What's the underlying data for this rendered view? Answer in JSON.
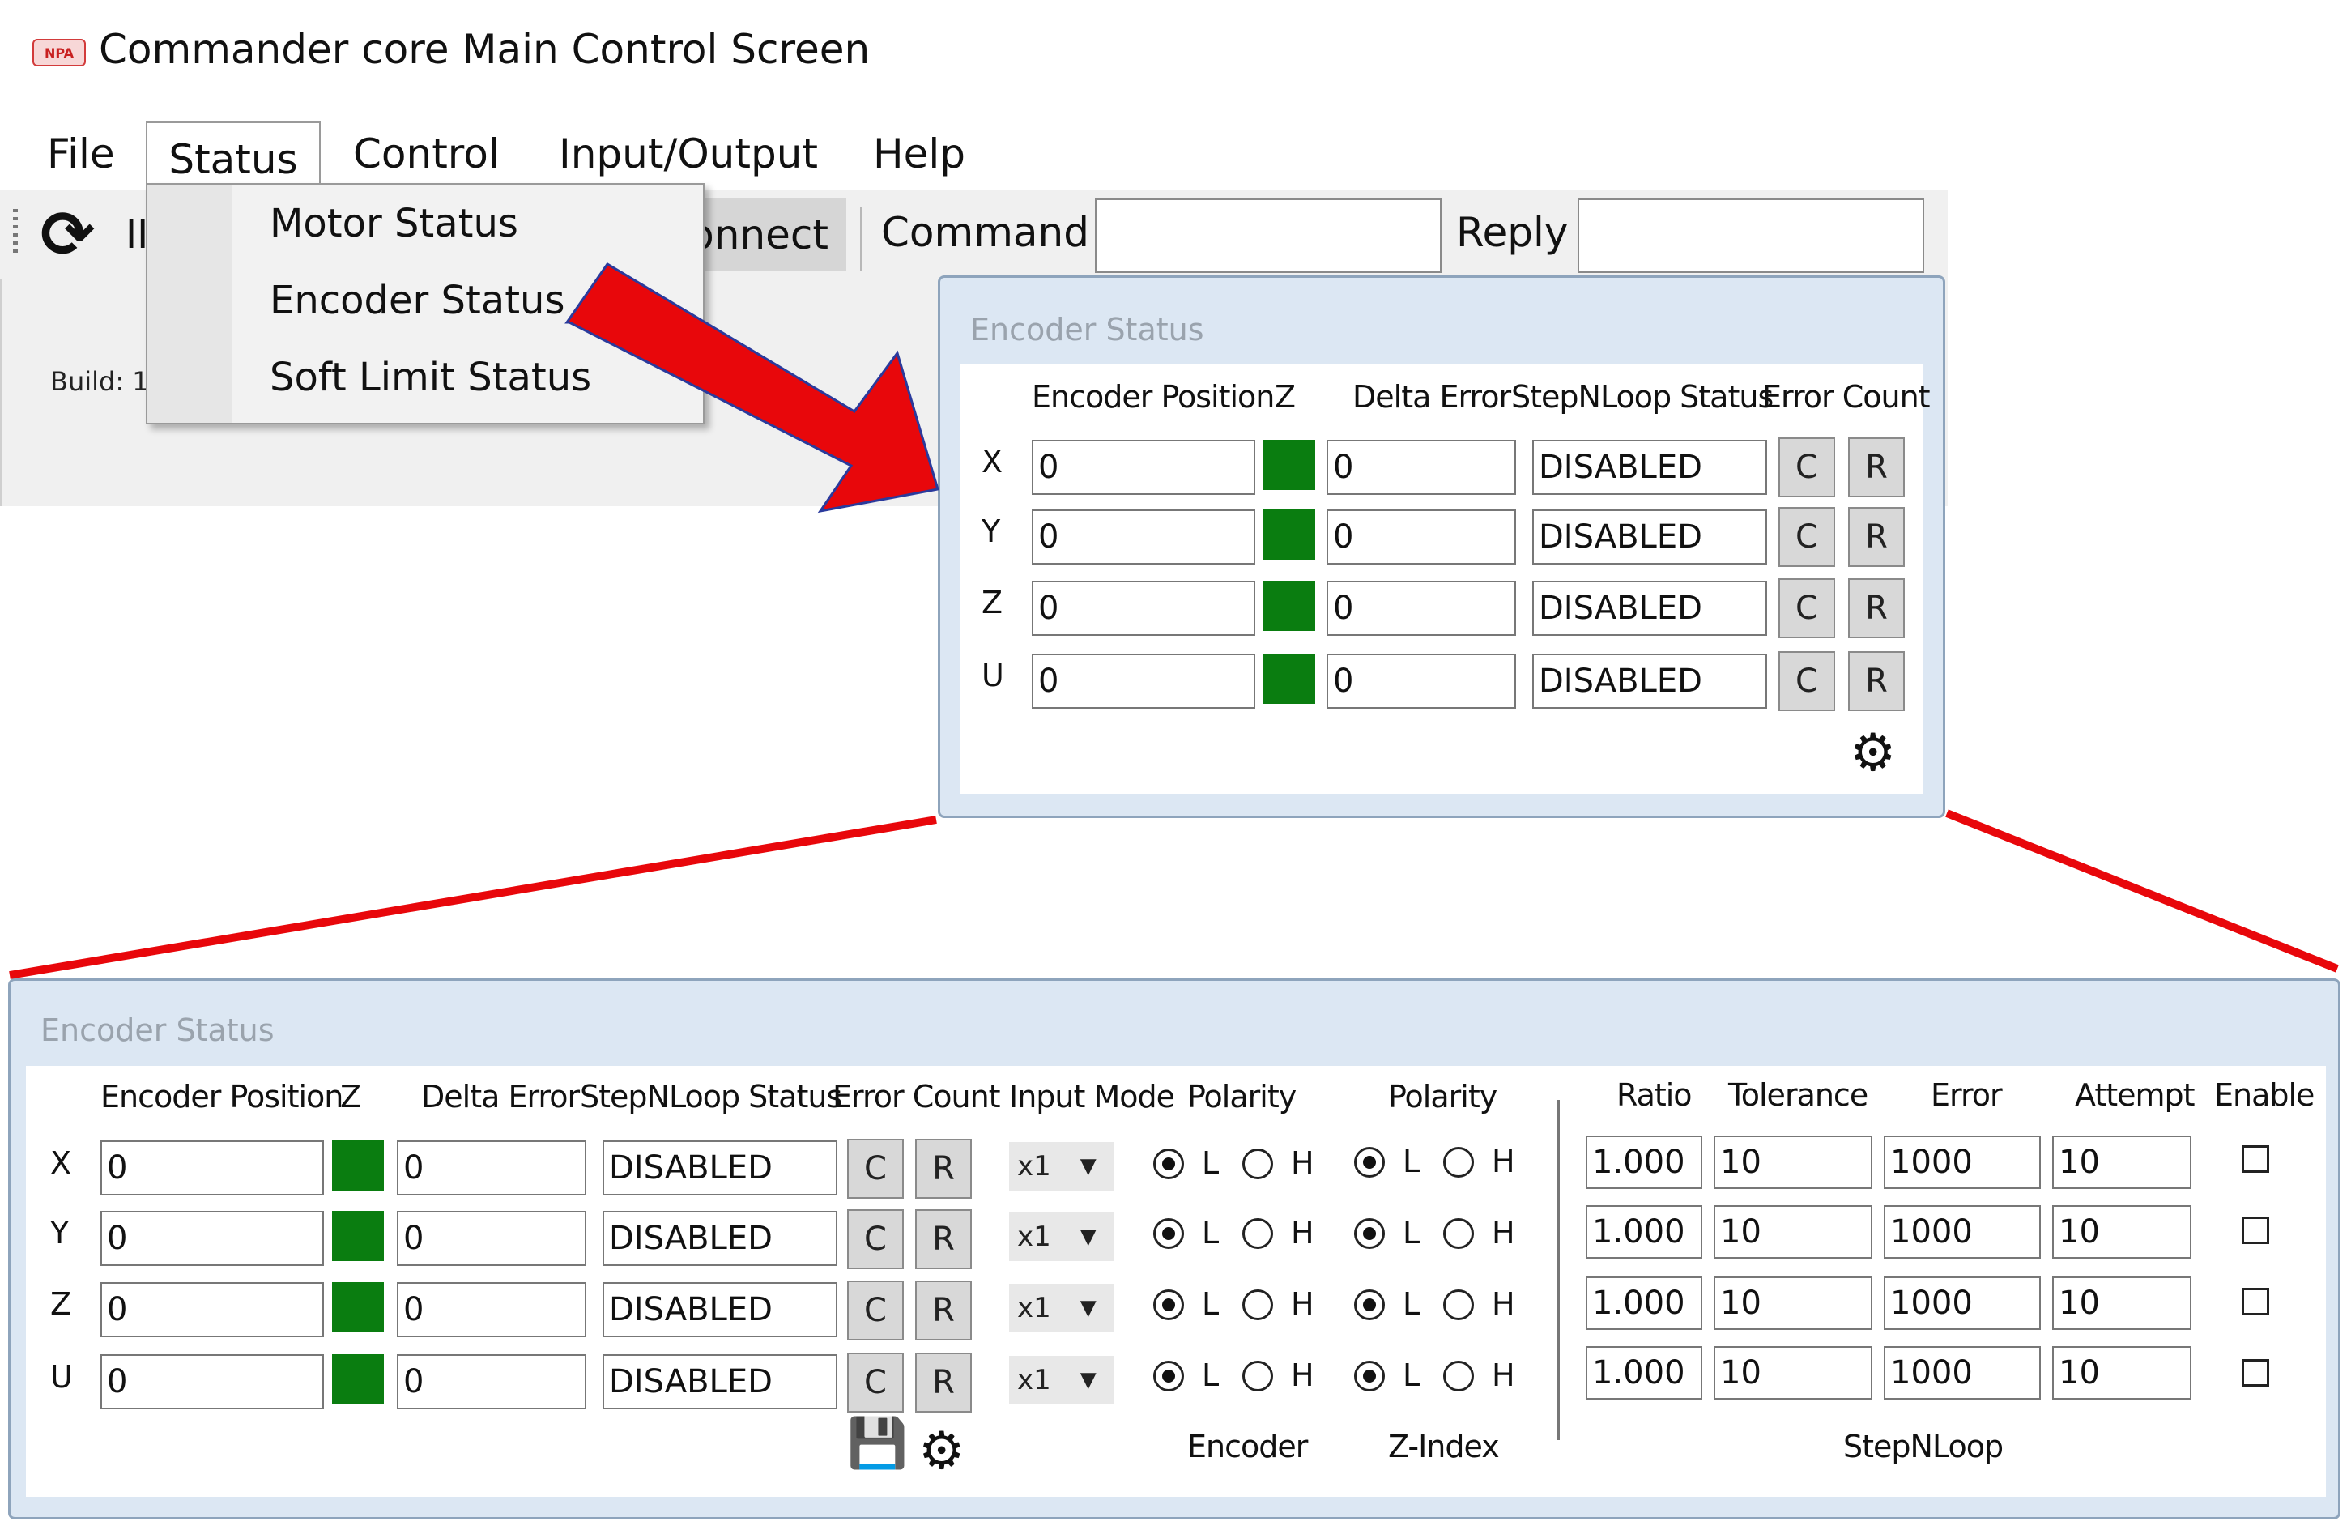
{
  "window": {
    "title": "Commander core Main Control Screen",
    "logo_text": "NPA"
  },
  "menu": {
    "file": "File",
    "status": "Status",
    "control": "Control",
    "io": "Input/Output",
    "help": "Help"
  },
  "dropdown": {
    "items": [
      "Motor Status",
      "Encoder Status",
      "Soft Limit Status"
    ]
  },
  "toolbar": {
    "clipped_label": "II",
    "connect_label": "onnect",
    "command_label": "Command",
    "command_value": "",
    "reply_label": "Reply",
    "reply_value": ""
  },
  "build_label": "Build: 1",
  "small_dialog": {
    "title": "Encoder Status",
    "headers": {
      "encoder_position": "Encoder Position",
      "z": "Z",
      "delta_error": "Delta Error",
      "stepnloop_status": "StepNLoop Status",
      "error_count": "Error Count"
    },
    "rows": [
      {
        "axis": "X",
        "position": "0",
        "delta": "0",
        "status": "DISABLED",
        "c": "C",
        "r": "R"
      },
      {
        "axis": "Y",
        "position": "0",
        "delta": "0",
        "status": "DISABLED",
        "c": "C",
        "r": "R"
      },
      {
        "axis": "Z",
        "position": "0",
        "delta": "0",
        "status": "DISABLED",
        "c": "C",
        "r": "R"
      },
      {
        "axis": "U",
        "position": "0",
        "delta": "0",
        "status": "DISABLED",
        "c": "C",
        "r": "R"
      }
    ]
  },
  "large_dialog": {
    "title": "Encoder Status",
    "headers": {
      "encoder_position": "Encoder Position",
      "z": "Z",
      "delta_error": "Delta Error",
      "stepnloop_status": "StepNLoop Status",
      "error_count": "Error Count",
      "input_mode": "Input Mode",
      "polarity_encoder": "Polarity",
      "polarity_zindex": "Polarity",
      "ratio": "Ratio",
      "tolerance": "Tolerance",
      "error": "Error",
      "attempt": "Attempt",
      "enable": "Enable"
    },
    "group_labels": {
      "encoder": "Encoder",
      "zindex": "Z-Index",
      "stepnloop": "StepNLoop"
    },
    "radio_labels": {
      "low": "L",
      "high": "H"
    },
    "rows": [
      {
        "axis": "X",
        "position": "0",
        "delta": "0",
        "status": "DISABLED",
        "c": "C",
        "r": "R",
        "input_mode": "x1",
        "enc_polarity": "L",
        "z_polarity": "L",
        "ratio": "1.000",
        "tolerance": "10",
        "error": "1000",
        "attempt": "10",
        "enable": false
      },
      {
        "axis": "Y",
        "position": "0",
        "delta": "0",
        "status": "DISABLED",
        "c": "C",
        "r": "R",
        "input_mode": "x1",
        "enc_polarity": "L",
        "z_polarity": "L",
        "ratio": "1.000",
        "tolerance": "10",
        "error": "1000",
        "attempt": "10",
        "enable": false
      },
      {
        "axis": "Z",
        "position": "0",
        "delta": "0",
        "status": "DISABLED",
        "c": "C",
        "r": "R",
        "input_mode": "x1",
        "enc_polarity": "L",
        "z_polarity": "L",
        "ratio": "1.000",
        "tolerance": "10",
        "error": "1000",
        "attempt": "10",
        "enable": false
      },
      {
        "axis": "U",
        "position": "0",
        "delta": "0",
        "status": "DISABLED",
        "c": "C",
        "r": "R",
        "input_mode": "x1",
        "enc_polarity": "L",
        "z_polarity": "L",
        "ratio": "1.000",
        "tolerance": "10",
        "error": "1000",
        "attempt": "10",
        "enable": false
      }
    ]
  },
  "colors": {
    "z_indicator": "#0a7d10",
    "annotation_red": "#e8070b",
    "dialog_frame": "#dce7f3"
  },
  "icons": {
    "refresh": "refresh-icon",
    "settings": "gear-icon",
    "save": "save-icon",
    "dropdown": "chevron-down-icon"
  }
}
